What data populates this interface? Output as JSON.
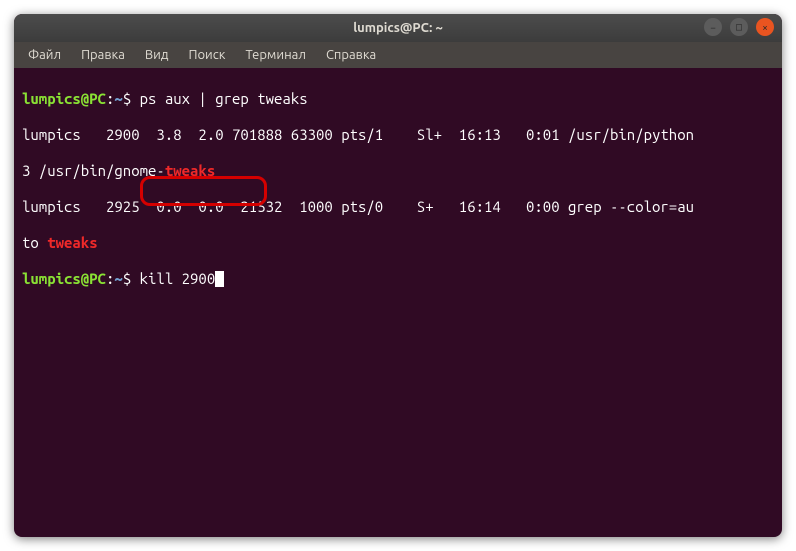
{
  "titlebar": {
    "title": "lumpics@PC: ~"
  },
  "menubar": {
    "items": [
      {
        "label": "Файл"
      },
      {
        "label": "Правка"
      },
      {
        "label": "Вид"
      },
      {
        "label": "Поиск"
      },
      {
        "label": "Терминал"
      },
      {
        "label": "Справка"
      }
    ]
  },
  "terminal": {
    "prompt_user_host": "lumpics@PC",
    "prompt_separator": ":",
    "prompt_path": "~",
    "prompt_dollar": "$",
    "commands": {
      "cmd1": " ps aux | grep tweaks",
      "cmd2": " kill 2900"
    },
    "output": {
      "line1_part1": "lumpics   2900  3.8  2.0 701888 63300 pts/1    Sl+  16:13   0:01 /usr/bin/python",
      "line2_part1": "3 /usr/bin/gnome-",
      "line2_highlight": "tweaks",
      "line3_part1": "lumpics   2925  0.0  0.0  21532  1000 pts/0    S+   16:14   0:00 grep --color=au",
      "line4_part1": "to ",
      "line4_highlight": "tweaks"
    }
  },
  "window_controls": {
    "min": "−",
    "max": "□",
    "close": "×"
  }
}
